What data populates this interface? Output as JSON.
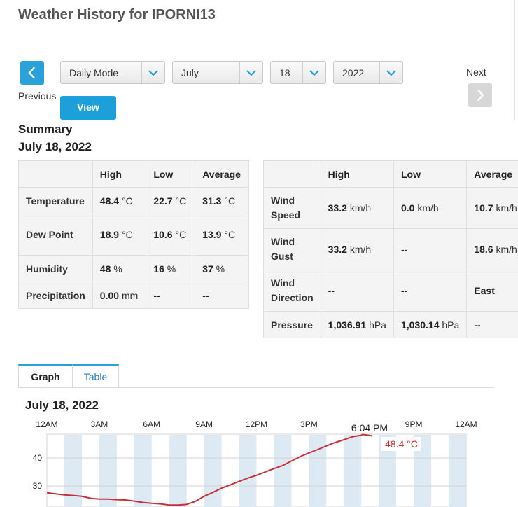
{
  "page": {
    "title": "Weather History for IPORNI13"
  },
  "nav": {
    "previous_label": "Previous",
    "next_label": "Next",
    "view_label": "View"
  },
  "selectors": {
    "mode": "Daily Mode",
    "month": "July",
    "day": "18",
    "year": "2022"
  },
  "summary": {
    "heading": "Summary",
    "date": "July 18, 2022",
    "headers": [
      "High",
      "Low",
      "Average"
    ],
    "left_rows": [
      {
        "label": "Temperature",
        "high_v": "48.4",
        "high_u": "°C",
        "low_v": "22.7",
        "low_u": "°C",
        "avg_v": "31.3",
        "avg_u": "°C"
      },
      {
        "label": "Dew Point",
        "high_v": "18.9",
        "high_u": "°C",
        "low_v": "10.6",
        "low_u": "°C",
        "avg_v": "13.9",
        "avg_u": "°C"
      },
      {
        "label": "Humidity",
        "high_v": "48",
        "high_u": "%",
        "low_v": "16",
        "low_u": "%",
        "avg_v": "37",
        "avg_u": "%"
      },
      {
        "label": "Precipitation",
        "high_v": "0.00",
        "high_u": "mm",
        "low_v": "--",
        "low_u": "",
        "avg_v": "--",
        "avg_u": ""
      }
    ],
    "right_rows": [
      {
        "label": "Wind Speed",
        "high_v": "33.2",
        "high_u": "km/h",
        "low_v": "0.0",
        "low_u": "km/h",
        "avg_v": "10.7",
        "avg_u": "km/h"
      },
      {
        "label": "Wind Gust",
        "high_v": "33.2",
        "high_u": "km/h",
        "low_v": "--",
        "low_u": "",
        "avg_v": "18.6",
        "avg_u": "km/h"
      },
      {
        "label": "Wind Direction",
        "high_v": "--",
        "high_u": "",
        "low_v": "--",
        "low_u": "",
        "avg_v": "East",
        "avg_u": ""
      },
      {
        "label": "Pressure",
        "high_v": "1,036.91",
        "high_u": "hPa",
        "low_v": "1,030.14",
        "low_u": "hPa",
        "avg_v": "--",
        "avg_u": ""
      }
    ]
  },
  "tabs": [
    {
      "label": "Graph",
      "active": true
    },
    {
      "label": "Table",
      "active": false
    }
  ],
  "graph": {
    "date": "July 18, 2022",
    "tooltip_time": "6:04 PM",
    "tooltip_value": "48.4 °C"
  },
  "colors": {
    "accent": "#2aa1d9",
    "line": "#c9303a",
    "stripe": "#dde9f3"
  },
  "chart_data": {
    "type": "line",
    "x_tick_labels": [
      "12AM",
      "3AM",
      "6AM",
      "9AM",
      "12PM",
      "3PM",
      "6PM",
      "9PM",
      "12AM"
    ],
    "y_tick_labels": [
      "40",
      "30"
    ],
    "x_range_hours": [
      0,
      24
    ],
    "series": [
      {
        "x": [
          0,
          0.5,
          1,
          1.5,
          2,
          2.5,
          3,
          3.5,
          4,
          4.5,
          5,
          5.5,
          6,
          6.5,
          7,
          7.5,
          8,
          8.5,
          9,
          9.5,
          10,
          10.5,
          11,
          11.5,
          12,
          12.5,
          13,
          13.5,
          14,
          14.5,
          15,
          15.5,
          16,
          16.5,
          17,
          17.5,
          18,
          18.07,
          18.3,
          18.6
        ],
        "y": [
          27.6,
          27.2,
          26.8,
          26.6,
          26.3,
          25.6,
          25.3,
          25.3,
          25.1,
          25.0,
          24.6,
          24.1,
          23.8,
          23.6,
          23.2,
          23.2,
          23.4,
          24.5,
          26.3,
          27.7,
          29.2,
          30.4,
          31.6,
          32.8,
          33.8,
          35.0,
          36.2,
          37.3,
          38.9,
          40.5,
          41.8,
          43.0,
          44.3,
          45.5,
          46.5,
          47.6,
          48.1,
          48.4,
          48.2,
          47.9
        ]
      }
    ]
  }
}
